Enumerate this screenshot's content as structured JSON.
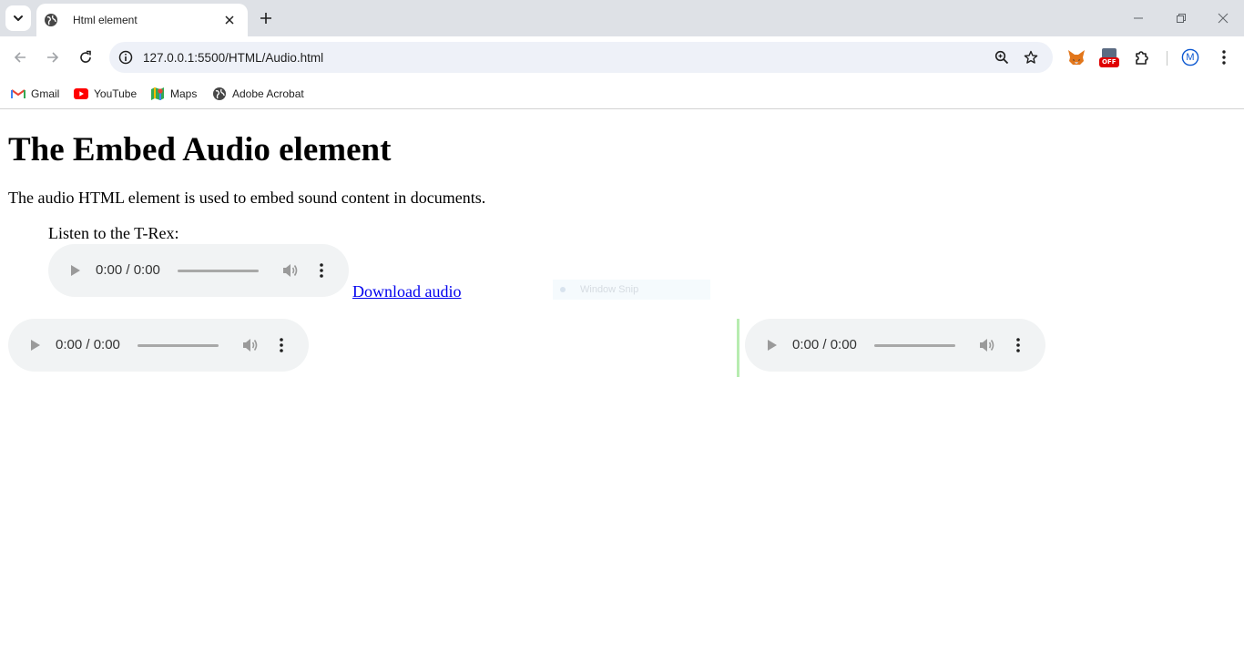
{
  "browser": {
    "tab": {
      "title": "Html element"
    },
    "address_bar": {
      "url": "127.0.0.1:5500/HTML/Audio.html"
    },
    "bookmarks": [
      {
        "label": "Gmail",
        "icon": "gmail-icon"
      },
      {
        "label": "YouTube",
        "icon": "youtube-icon"
      },
      {
        "label": "Maps",
        "icon": "maps-icon"
      },
      {
        "label": "Adobe Acrobat",
        "icon": "globe-icon"
      }
    ],
    "extension_badge": "OFF",
    "profile_initial": "M",
    "colors": {
      "tabstrip": "#dee1e6",
      "omnibox": "#eef1f8",
      "accent": "#0b57d0"
    }
  },
  "page": {
    "title": "The Embed Audio element",
    "intro": "The audio HTML element is used to embed sound content in documents.",
    "figure_caption": "Listen to the T-Rex:",
    "download_link": "Download audio",
    "players": [
      {
        "time": "0:00 / 0:00"
      },
      {
        "time": "0:00 / 0:00"
      },
      {
        "time": "0:00 / 0:00"
      }
    ],
    "overlay_text": "Window Snip"
  }
}
